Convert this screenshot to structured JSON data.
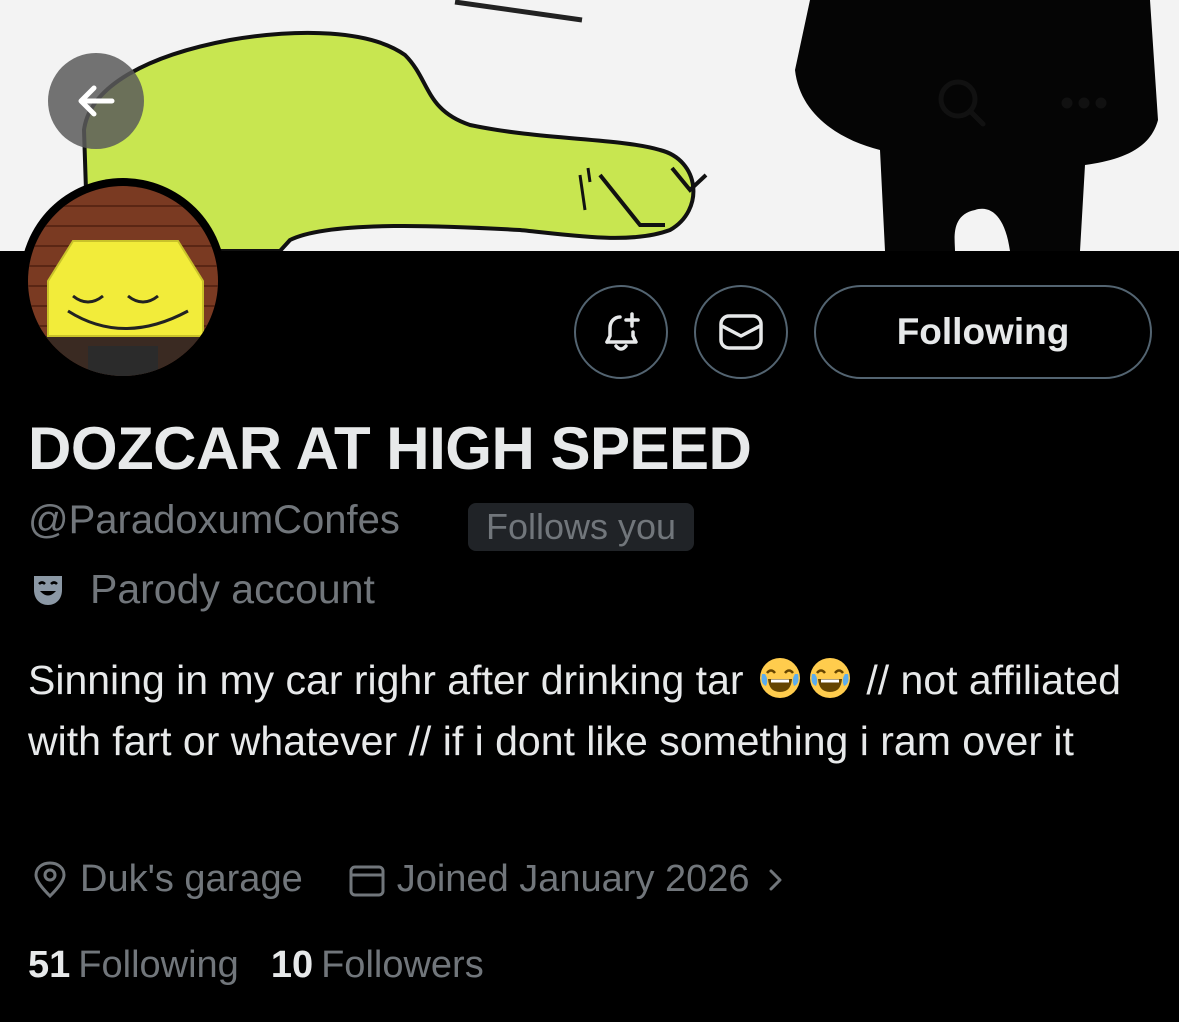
{
  "header": {
    "back_icon": "arrow-left-icon",
    "search_icon": "search-icon",
    "more_icon": "more-horizontal-icon"
  },
  "profile": {
    "display_name": "DOZCAR AT HIGH SPEED",
    "handle": "@ParadoxumConfes",
    "follows_you": "Follows you",
    "parody_label": "Parody account",
    "parody_icon": "theater-mask-icon",
    "bio_part1": "Sinning in my car righr after drinking tar",
    "bio_emoji": "face-with-tears-of-joy",
    "bio_part2": "// not affiliated with fart or whatever // if i dont like something i ram over it",
    "location": "Duk's garage",
    "joined": "Joined January 2026",
    "following_count": "51",
    "following_label": "Following",
    "followers_count": "10",
    "followers_label": "Followers"
  },
  "actions": {
    "notify_icon": "bell-plus-icon",
    "message_icon": "envelope-icon",
    "following_button": "Following"
  },
  "colors": {
    "background": "#000000",
    "primary_text": "#e7e9ea",
    "secondary_text": "#71767b",
    "border": "#536471",
    "banner_green": "#c8e650"
  }
}
